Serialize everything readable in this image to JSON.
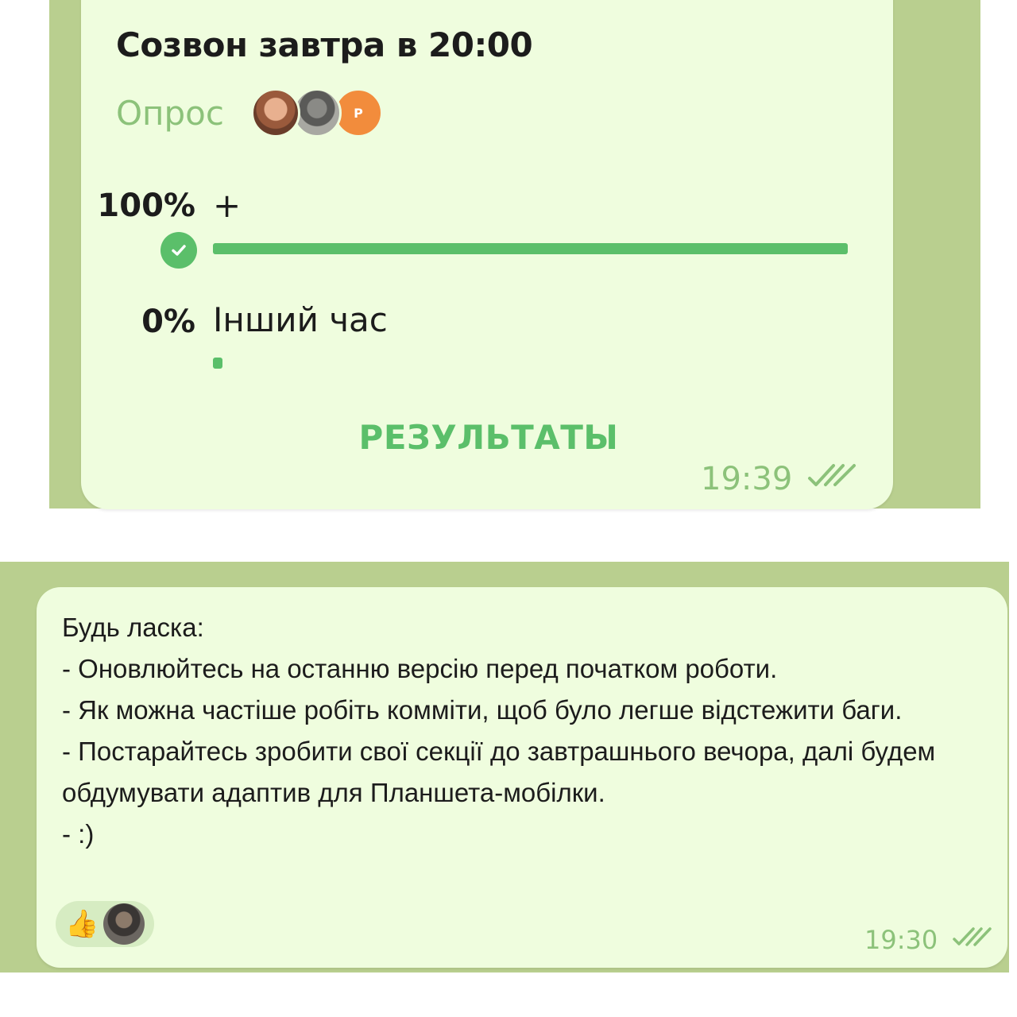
{
  "poll": {
    "question": "Созвон завтра в 20:00",
    "type_label": "Опрос",
    "voter_initial": "P",
    "options": [
      {
        "percent_text": "100%",
        "label": "+",
        "fraction": 1.0,
        "selected": true
      },
      {
        "percent_text": "0%",
        "label": "Інший час",
        "fraction": 0.0,
        "selected": false
      }
    ],
    "results_button": "РЕЗУЛЬТАТЫ",
    "time": "19:39",
    "status": "read"
  },
  "message": {
    "lines": [
      "Будь ласка:",
      "- Оновлюйтесь на останню версію перед початком роботи.",
      "- Як можна частіше робіть комміти, щоб було легше відстежити баги.",
      "- Постарайтесь зробити свої секції до завтрашнього вечора, далі будем обдумувати адаптив для Планшета-мобілки.",
      "- :)"
    ],
    "reaction_emoji": "👍",
    "time": "19:30",
    "status": "read"
  },
  "colors": {
    "bubble": "#effdde",
    "accent": "#5bbf6a",
    "meta": "#8cc27a",
    "chat_background": "#b9cf8f"
  }
}
